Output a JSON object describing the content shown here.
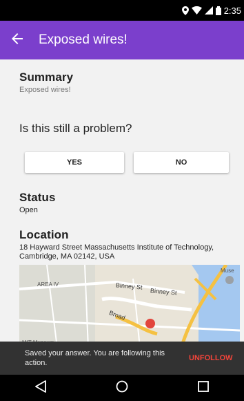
{
  "status_bar": {
    "time": "2:35"
  },
  "app_bar": {
    "title": "Exposed wires!"
  },
  "summary": {
    "heading": "Summary",
    "text": "Exposed wires!"
  },
  "question": {
    "heading": "Is this still a problem?",
    "yes_label": "YES",
    "no_label": "NO"
  },
  "status": {
    "heading": "Status",
    "value": "Open"
  },
  "location": {
    "heading": "Location",
    "address": "18 Hayward Street Massachusetts Institute of Technology, Cambridge, MA 02142, USA",
    "map_labels": [
      "AREA IV",
      "Binney St",
      "Binney St",
      "Broad",
      "MIT Museum",
      "Muse"
    ]
  },
  "snackbar": {
    "message": "Saved your answer. You are following this action.",
    "action": "UNFOLLOW"
  },
  "colors": {
    "primary": "#7b3fcc",
    "accent": "#f2443a",
    "snackbar": "#323232"
  },
  "icons": [
    "location-pin-icon",
    "wifi-icon",
    "signal-icon",
    "battery-icon",
    "back-arrow-icon",
    "nav-back-icon",
    "nav-home-icon",
    "nav-recents-icon"
  ]
}
